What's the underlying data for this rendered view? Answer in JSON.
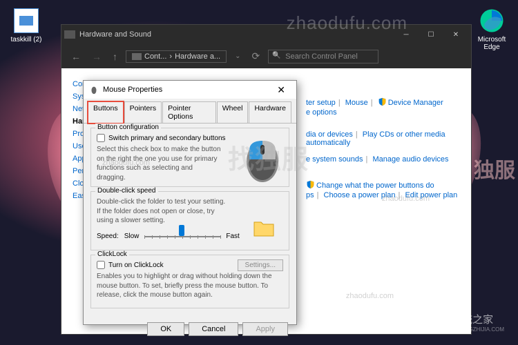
{
  "desktop": {
    "icons": {
      "taskkill": "taskkill (2)",
      "edge": "Microsoft\nEdge"
    }
  },
  "window": {
    "title": "Hardware and Sound",
    "path": {
      "p1": "Cont...",
      "sep": "›",
      "p2": "Hardware a..."
    },
    "search_placeholder": "Search Control Panel",
    "sidebar": [
      "Contr",
      "Syste",
      "Netw",
      "Hard",
      "Progr",
      "User",
      "Appe",
      "Perso",
      "Clock",
      "Ease"
    ],
    "links": {
      "row1": {
        "a": "ter setup",
        "b": "Mouse",
        "c": "Device Manager"
      },
      "row2": {
        "a": "e options"
      },
      "row3": {
        "a": "dia or devices",
        "b": "Play CDs or other media automatically"
      },
      "row4": {
        "a": "e system sounds",
        "b": "Manage audio devices"
      },
      "row5": {
        "a": "Change what the power buttons do"
      },
      "row6": {
        "a": "ps",
        "b": "Choose a power plan",
        "c": "Edit power plan"
      }
    }
  },
  "dialog": {
    "title": "Mouse Properties",
    "tabs": [
      "Buttons",
      "Pointers",
      "Pointer Options",
      "Wheel",
      "Hardware"
    ],
    "group1": {
      "legend": "Button configuration",
      "checkbox": "Switch primary and secondary buttons",
      "desc": "Select this check box to make the button on the right the one you use for primary functions such as selecting and dragging."
    },
    "group2": {
      "legend": "Double-click speed",
      "desc": "Double-click the folder to test your setting. If the folder does not open or close, try using a slower setting.",
      "speed_label": "Speed:",
      "slow": "Slow",
      "fast": "Fast"
    },
    "group3": {
      "legend": "ClickLock",
      "checkbox": "Turn on ClickLock",
      "settings_btn": "Settings...",
      "desc": "Enables you to highlight or drag without holding down the mouse button. To set, briefly press the mouse button. To release, click the mouse button again."
    },
    "buttons": {
      "ok": "OK",
      "cancel": "Cancel",
      "apply": "Apply"
    }
  },
  "watermarks": {
    "top": "zhaodufu.com",
    "mid": "找独服",
    "cn_side": "独服",
    "url": "zhaodufu.com",
    "brand": "系统之家",
    "brand_url": "XITONGZHIJIA.COM"
  }
}
